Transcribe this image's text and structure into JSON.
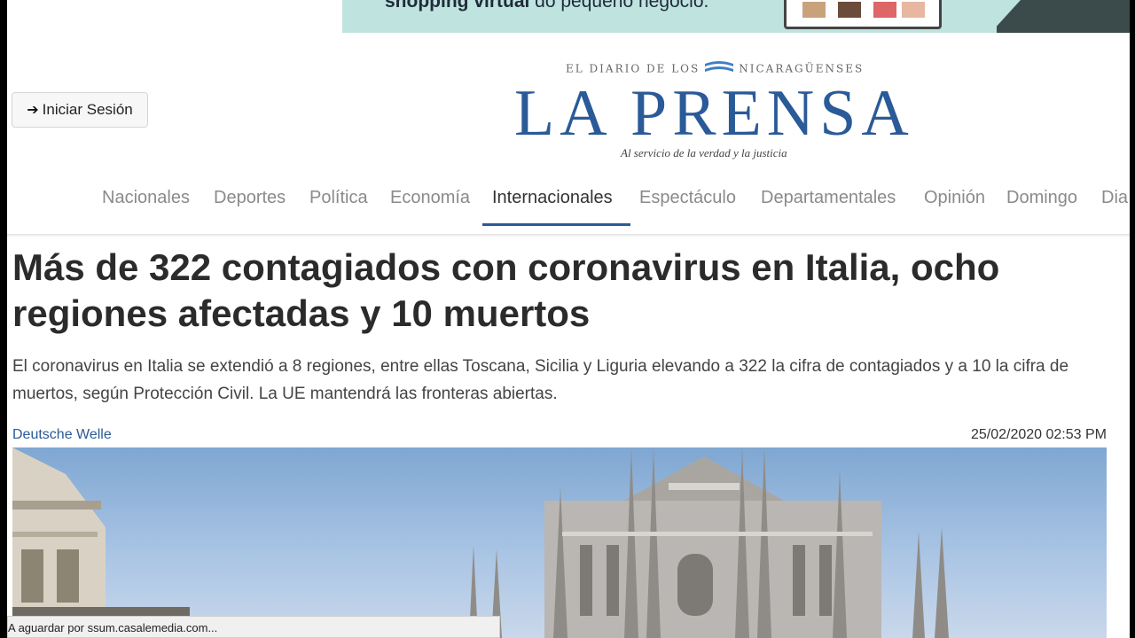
{
  "ad": {
    "text_bold": "shopping virtual",
    "text_rest": " do pequeno negócio."
  },
  "header": {
    "login_label": "Iniciar Sesión",
    "tagline_left": "EL DIARIO DE LOS",
    "tagline_right": "NICARAGÜENSES",
    "logo": "LA PRENSA",
    "slogan": "Al servicio de la verdad y la justicia"
  },
  "nav": {
    "items": [
      {
        "label": "Nacionales"
      },
      {
        "label": "Deportes"
      },
      {
        "label": "Política"
      },
      {
        "label": "Economía"
      },
      {
        "label": "Internacionales"
      },
      {
        "label": "Espectáculo"
      },
      {
        "label": "Departamentales"
      },
      {
        "label": "Opinión"
      },
      {
        "label": "Domingo"
      },
      {
        "label": "Dia"
      }
    ],
    "active": "Internacionales"
  },
  "article": {
    "headline": "Más de 322 contagiados con coronavirus en Italia, ocho regiones afectadas y 10 muertos",
    "lead": "El coronavirus en Italia se extendió a 8 regiones, entre ellas Toscana, Sicilia y Liguria elevando a 322 la cifra de contagiados y a 10 la cifra de muertos, según Protección Civil. La UE mantendrá las fronteras abiertas.",
    "source": "Deutsche Welle",
    "date": "25/02/2020 02:53 PM"
  },
  "status_bar": {
    "text": "A aguardar por ssum.casalemedia.com..."
  },
  "colors": {
    "brand": "#2a5a97",
    "headline": "#2b2b2b",
    "nav_inactive": "#8a8a8a"
  }
}
